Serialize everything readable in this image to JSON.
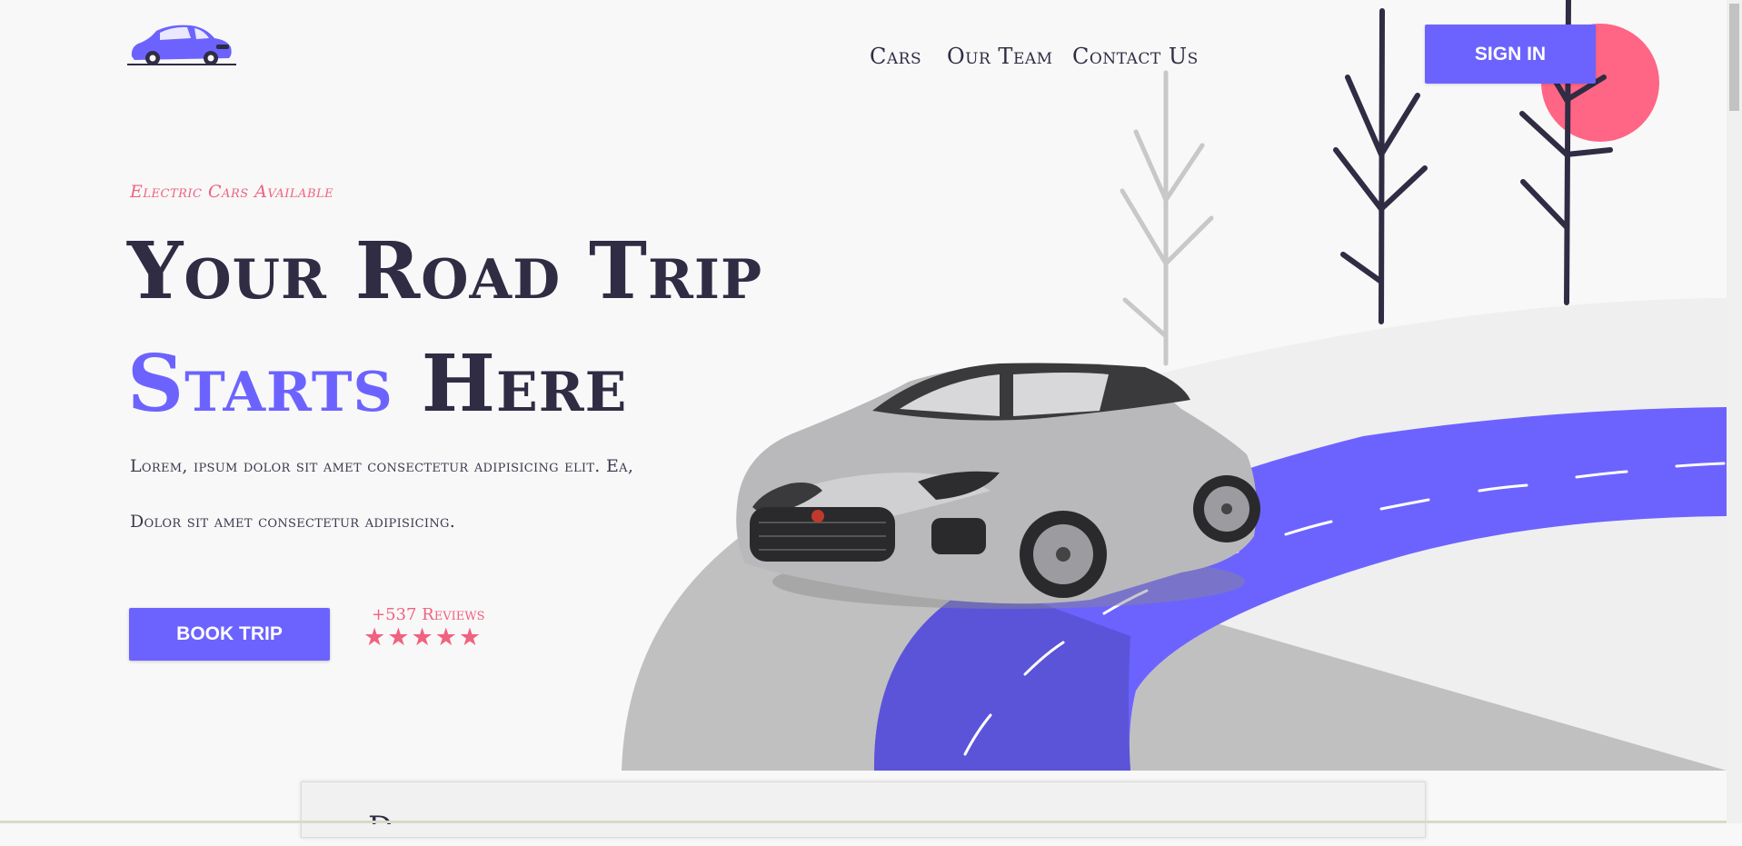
{
  "nav": {
    "links": [
      "Cars",
      "Our Team",
      "Contact Us"
    ],
    "sign_in": "SIGN IN"
  },
  "hero": {
    "tagline": "Electric Cars Available",
    "title_line1": "Your Road Trip",
    "title_accent": "Starts",
    "title_line2_rest": " Here",
    "description_line1": "Lorem, ipsum dolor sit amet consectetur adipisicing elit. Ea,",
    "description_line2": "Dolor sit amet consectetur adipisicing.",
    "book_button": "BOOK TRIP",
    "reviews": "+537 Reviews",
    "rating": 5
  },
  "colors": {
    "primary": "#6c63ff",
    "accent": "#f0627f",
    "dark": "#2f2c44",
    "background": "#f8f8f8"
  },
  "icons": [
    "car-logo-icon",
    "star-icon"
  ],
  "section_card": {
    "partial_letter": "D"
  }
}
